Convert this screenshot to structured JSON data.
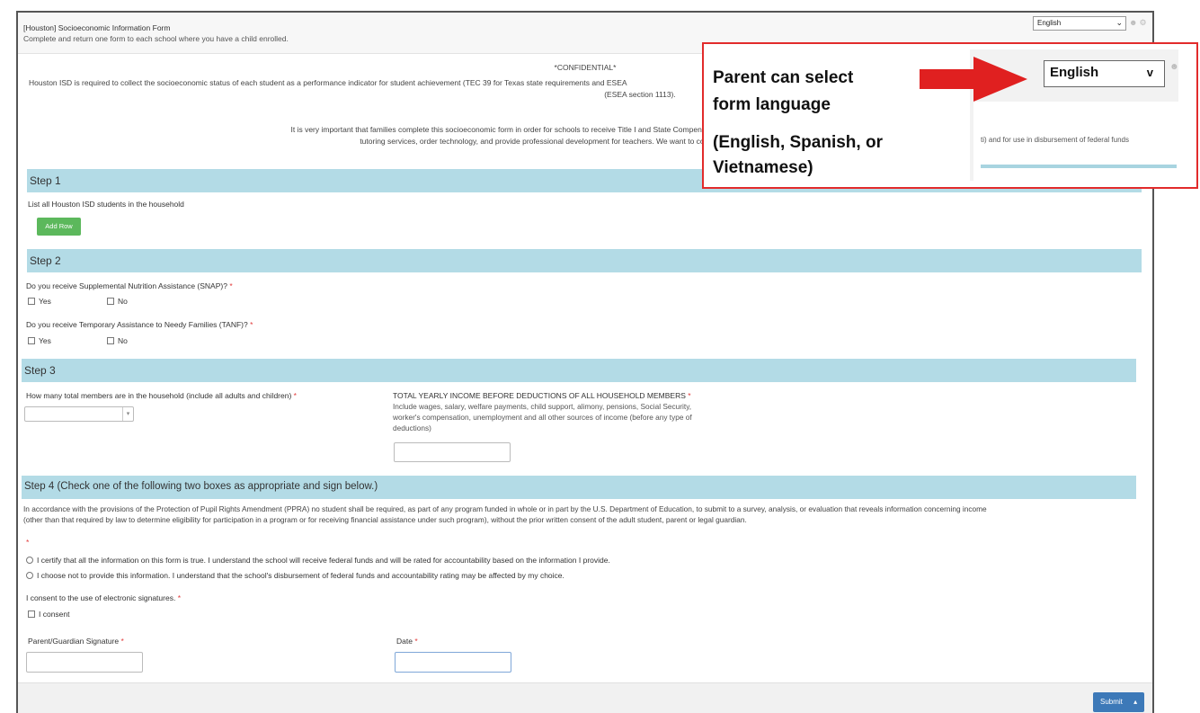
{
  "header": {
    "title": "[Houston] Socioeconomic Information Form",
    "subtitle": "Complete and return one form to each school where you have a child enrolled.",
    "language": "English",
    "icons": [
      "user-icon",
      "gear-icon"
    ]
  },
  "intro": {
    "confidential": "*CONFIDENTIAL*",
    "paragraph1": "Houston ISD is required to collect the socioeconomic status of each student as a performance indicator for student achievement (TEC 39 for Texas state requirements and ESEA",
    "paragraph1_line2": "(ESEA section 1113).",
    "paragraph2": "It is very important that families complete this socioeconomic form in order for schools to receive Title I and State Compensatory Education funding. This funding will directly be",
    "paragraph2_line2": "tutoring services, order technology, and provide professional development for teachers. We want to continue to provide these necessa"
  },
  "step1": {
    "title": "Step 1",
    "instruction": "List all Houston ISD students in the household",
    "add_row": "Add Row"
  },
  "step2": {
    "title": "Step 2",
    "q_snap": "Do you receive  Supplemental Nutrition Assistance (SNAP)?",
    "q_tanf": "Do you receive  Temporary Assistance to Needy Families (TANF)?",
    "yes": "Yes",
    "no": "No",
    "required_mark": "*"
  },
  "step3": {
    "title": "Step 3",
    "members_label": "How many total members are in the household (include all adults and children)",
    "income_label": "TOTAL YEARLY INCOME BEFORE DEDUCTIONS OF ALL HOUSEHOLD MEMBERS",
    "income_help_1": "Include wages, salary, welfare payments, child support, alimony, pensions, Social Security,",
    "income_help_2": "worker's compensation, unemployment and all other sources of income (before any type of",
    "income_help_3": "deductions)"
  },
  "step4": {
    "title": "Step 4 (Check one of the following two boxes as appropriate and sign below.)",
    "ppra_1": "In accordance with the provisions of the Protection of Pupil Rights Amendment (PPRA) no student shall be required, as part of any program funded in whole or in part by the U.S. Department of Education, to submit to a survey, analysis, or evaluation that reveals information concerning income",
    "ppra_2": "(other than that required by law to determine eligibility for participation in a program or for receiving financial assistance under such program), without the prior written consent of the adult student, parent or legal guardian.",
    "certify": "I certify that all the information on this form is true. I understand the school will receive federal funds and will be rated for accountability based on the information I provide.",
    "decline": "I choose not to provide this information. I understand that the school's disbursement of federal funds and accountability rating may be affected by my choice.",
    "consent_label": "I consent to the use of electronic signatures.",
    "consent_option": "I consent",
    "signature_label": "Parent/Guardian Signature",
    "date_label": "Date"
  },
  "footer": {
    "submit": "Submit",
    "caret": "▴"
  },
  "callout": {
    "line1": "Parent can select",
    "line2": "form language",
    "line3": "(English, Spanish, or",
    "line4": "Vietnamese)",
    "zoom_language": "English",
    "zoom_chevron": "v",
    "zoom_text": "ti) and for use in disbursement of federal funds"
  },
  "colors": {
    "step_bar": "#b3dbe6",
    "callout_border": "#e22b2b",
    "add_button": "#5cb85c",
    "submit_button": "#3d79b8",
    "required": "#e23b3b"
  }
}
